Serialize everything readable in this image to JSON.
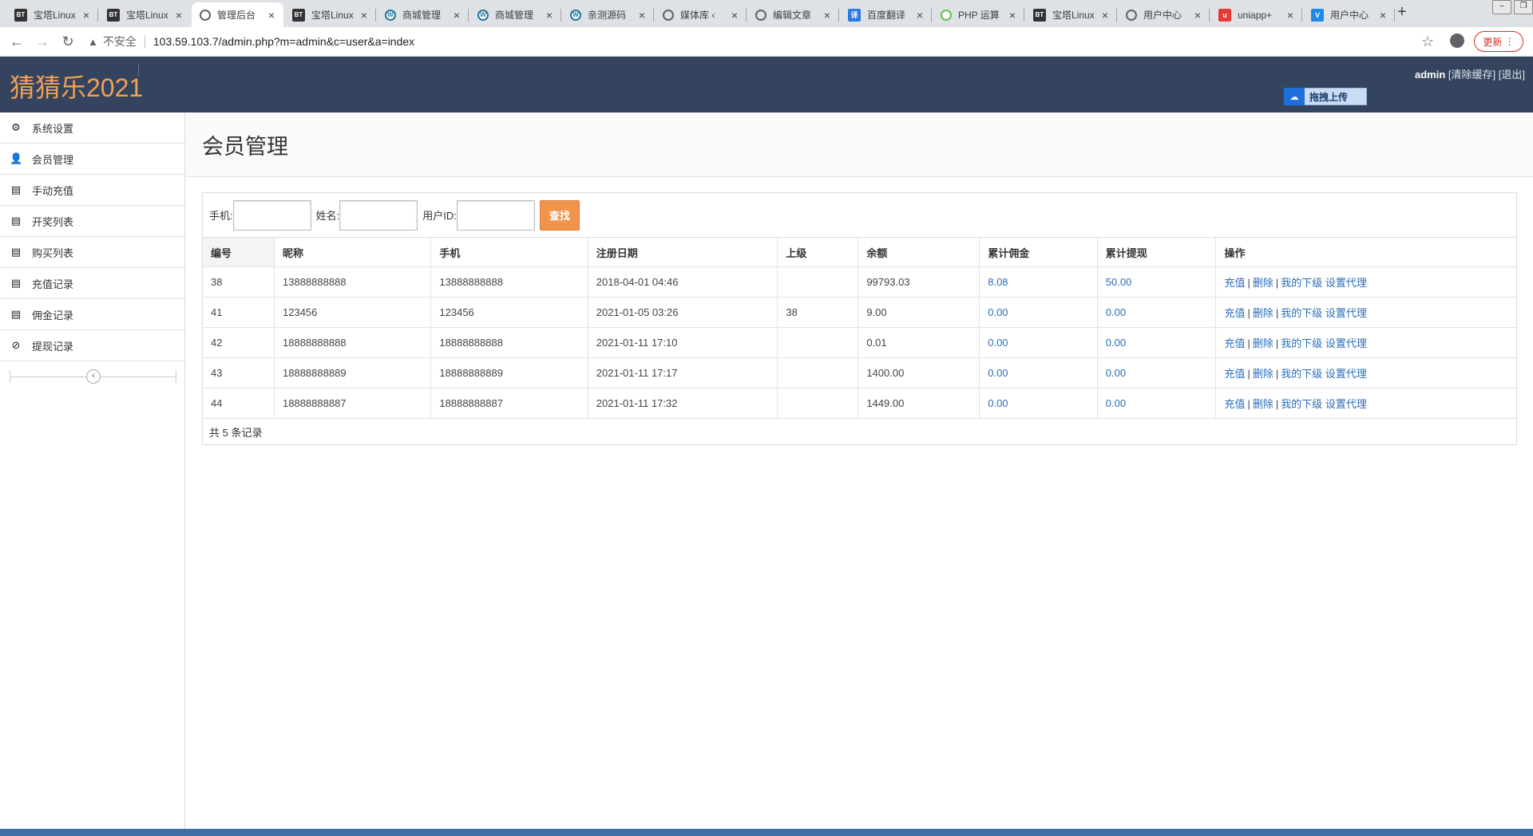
{
  "browser": {
    "tabs": [
      {
        "title": "宝塔Linux",
        "fav": "bt",
        "active": false
      },
      {
        "title": "宝塔Linux",
        "fav": "bt",
        "active": false
      },
      {
        "title": "管理后台",
        "fav": "globe",
        "active": true
      },
      {
        "title": "宝塔Linux",
        "fav": "bt",
        "active": false
      },
      {
        "title": "商城管理",
        "fav": "wp",
        "active": false
      },
      {
        "title": "商城管理",
        "fav": "wp",
        "active": false
      },
      {
        "title": "亲测源码",
        "fav": "wp",
        "active": false
      },
      {
        "title": "媒体库 ‹",
        "fav": "globe",
        "active": false
      },
      {
        "title": "编辑文章",
        "fav": "globe",
        "active": false
      },
      {
        "title": "百度翻译",
        "fav": "fy",
        "active": false
      },
      {
        "title": "PHP 运算",
        "fav": "php",
        "active": false
      },
      {
        "title": "宝塔Linux",
        "fav": "bt",
        "active": false
      },
      {
        "title": "用户中心",
        "fav": "globe",
        "active": false
      },
      {
        "title": "uniapp+",
        "fav": "uni",
        "active": false
      },
      {
        "title": "用户中心",
        "fav": "vue",
        "active": false
      }
    ],
    "new_tab": "+",
    "insecure_label": "不安全",
    "url": "103.59.103.7/admin.php?m=admin&c=user&a=index",
    "update_label": "更新"
  },
  "header": {
    "logo": "猜猜乐2021",
    "username": "admin",
    "clear_cache": "[清除缓存]",
    "logout": "[退出]",
    "upload_label": "拖拽上传"
  },
  "sidebar": {
    "items": [
      {
        "label": "系统设置",
        "icon": "⚙",
        "name": "gear-icon"
      },
      {
        "label": "会员管理",
        "icon": "👤",
        "name": "user-icon"
      },
      {
        "label": "手动充值",
        "icon": "▤",
        "name": "list-icon"
      },
      {
        "label": "开奖列表",
        "icon": "▤",
        "name": "list-icon"
      },
      {
        "label": "购买列表",
        "icon": "▤",
        "name": "list-icon"
      },
      {
        "label": "充值记录",
        "icon": "▤",
        "name": "list-icon"
      },
      {
        "label": "佣金记录",
        "icon": "▤",
        "name": "list-icon"
      },
      {
        "label": "提现记录",
        "icon": "⊘",
        "name": "ban-icon"
      }
    ],
    "collapse_icon": "‹"
  },
  "main": {
    "title": "会员管理",
    "search": {
      "phone_label": "手机:",
      "name_label": "姓名:",
      "userid_label": "用户ID:",
      "button": "查找"
    },
    "table": {
      "columns": [
        "编号",
        "昵称",
        "手机",
        "注册日期",
        "上级",
        "余额",
        "累计佣金",
        "累计提现",
        "操作"
      ],
      "rows": [
        [
          "38",
          "13888888888",
          "13888888888",
          "2018-04-01 04:46",
          "",
          "99793.03",
          "8.08",
          "50.00"
        ],
        [
          "41",
          "123456",
          "123456",
          "2021-01-05 03:26",
          "38",
          "9.00",
          "0.00",
          "0.00"
        ],
        [
          "42",
          "18888888888",
          "18888888888",
          "2021-01-11 17:10",
          "",
          "0.01",
          "0.00",
          "0.00"
        ],
        [
          "43",
          "18888888889",
          "18888888889",
          "2021-01-11 17:17",
          "",
          "1400.00",
          "0.00",
          "0.00"
        ],
        [
          "44",
          "18888888887",
          "18888888887",
          "2021-01-11 17:32",
          "",
          "1449.00",
          "0.00",
          "0.00"
        ]
      ],
      "ops": {
        "recharge": "充值",
        "sep": "|",
        "delete": "删除",
        "subordinates": "我的下级",
        "set_agent": "设置代理"
      }
    },
    "footer": "共 5 条记录"
  },
  "colors": {
    "header_bg": "#34445e",
    "logo": "#f0a05a",
    "search_button": "#f0934d",
    "link": "#2a6ebb"
  }
}
